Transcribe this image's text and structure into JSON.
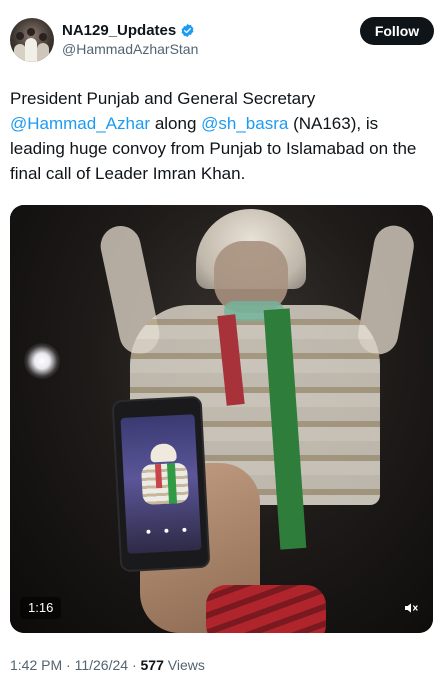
{
  "author": {
    "display_name": "NA129_Updates",
    "handle": "@HammadAzharStan",
    "verified": true,
    "verified_color": "#1d9bf0"
  },
  "follow_button": {
    "label": "Follow"
  },
  "tweet": {
    "text_parts": {
      "p1": "President Punjab and General Secretary ",
      "mention1": "@Hammad_Azhar",
      "p2": " along ",
      "mention2": "@sh_basra",
      "p3": " (NA163), is leading huge convoy from Punjab to Islamabad on the final call of Leader Imran Khan."
    }
  },
  "media": {
    "type": "video",
    "duration": "1:16",
    "muted_icon": "speaker-muted-icon"
  },
  "meta": {
    "time": "1:42 PM",
    "sep1": " · ",
    "date": "11/26/24",
    "sep2": " · ",
    "views_count": "577",
    "views_label": " Views"
  },
  "colors": {
    "text": "#0f1419",
    "secondary": "#536471",
    "link": "#1d9bf0",
    "follow_bg": "#0f1419"
  }
}
